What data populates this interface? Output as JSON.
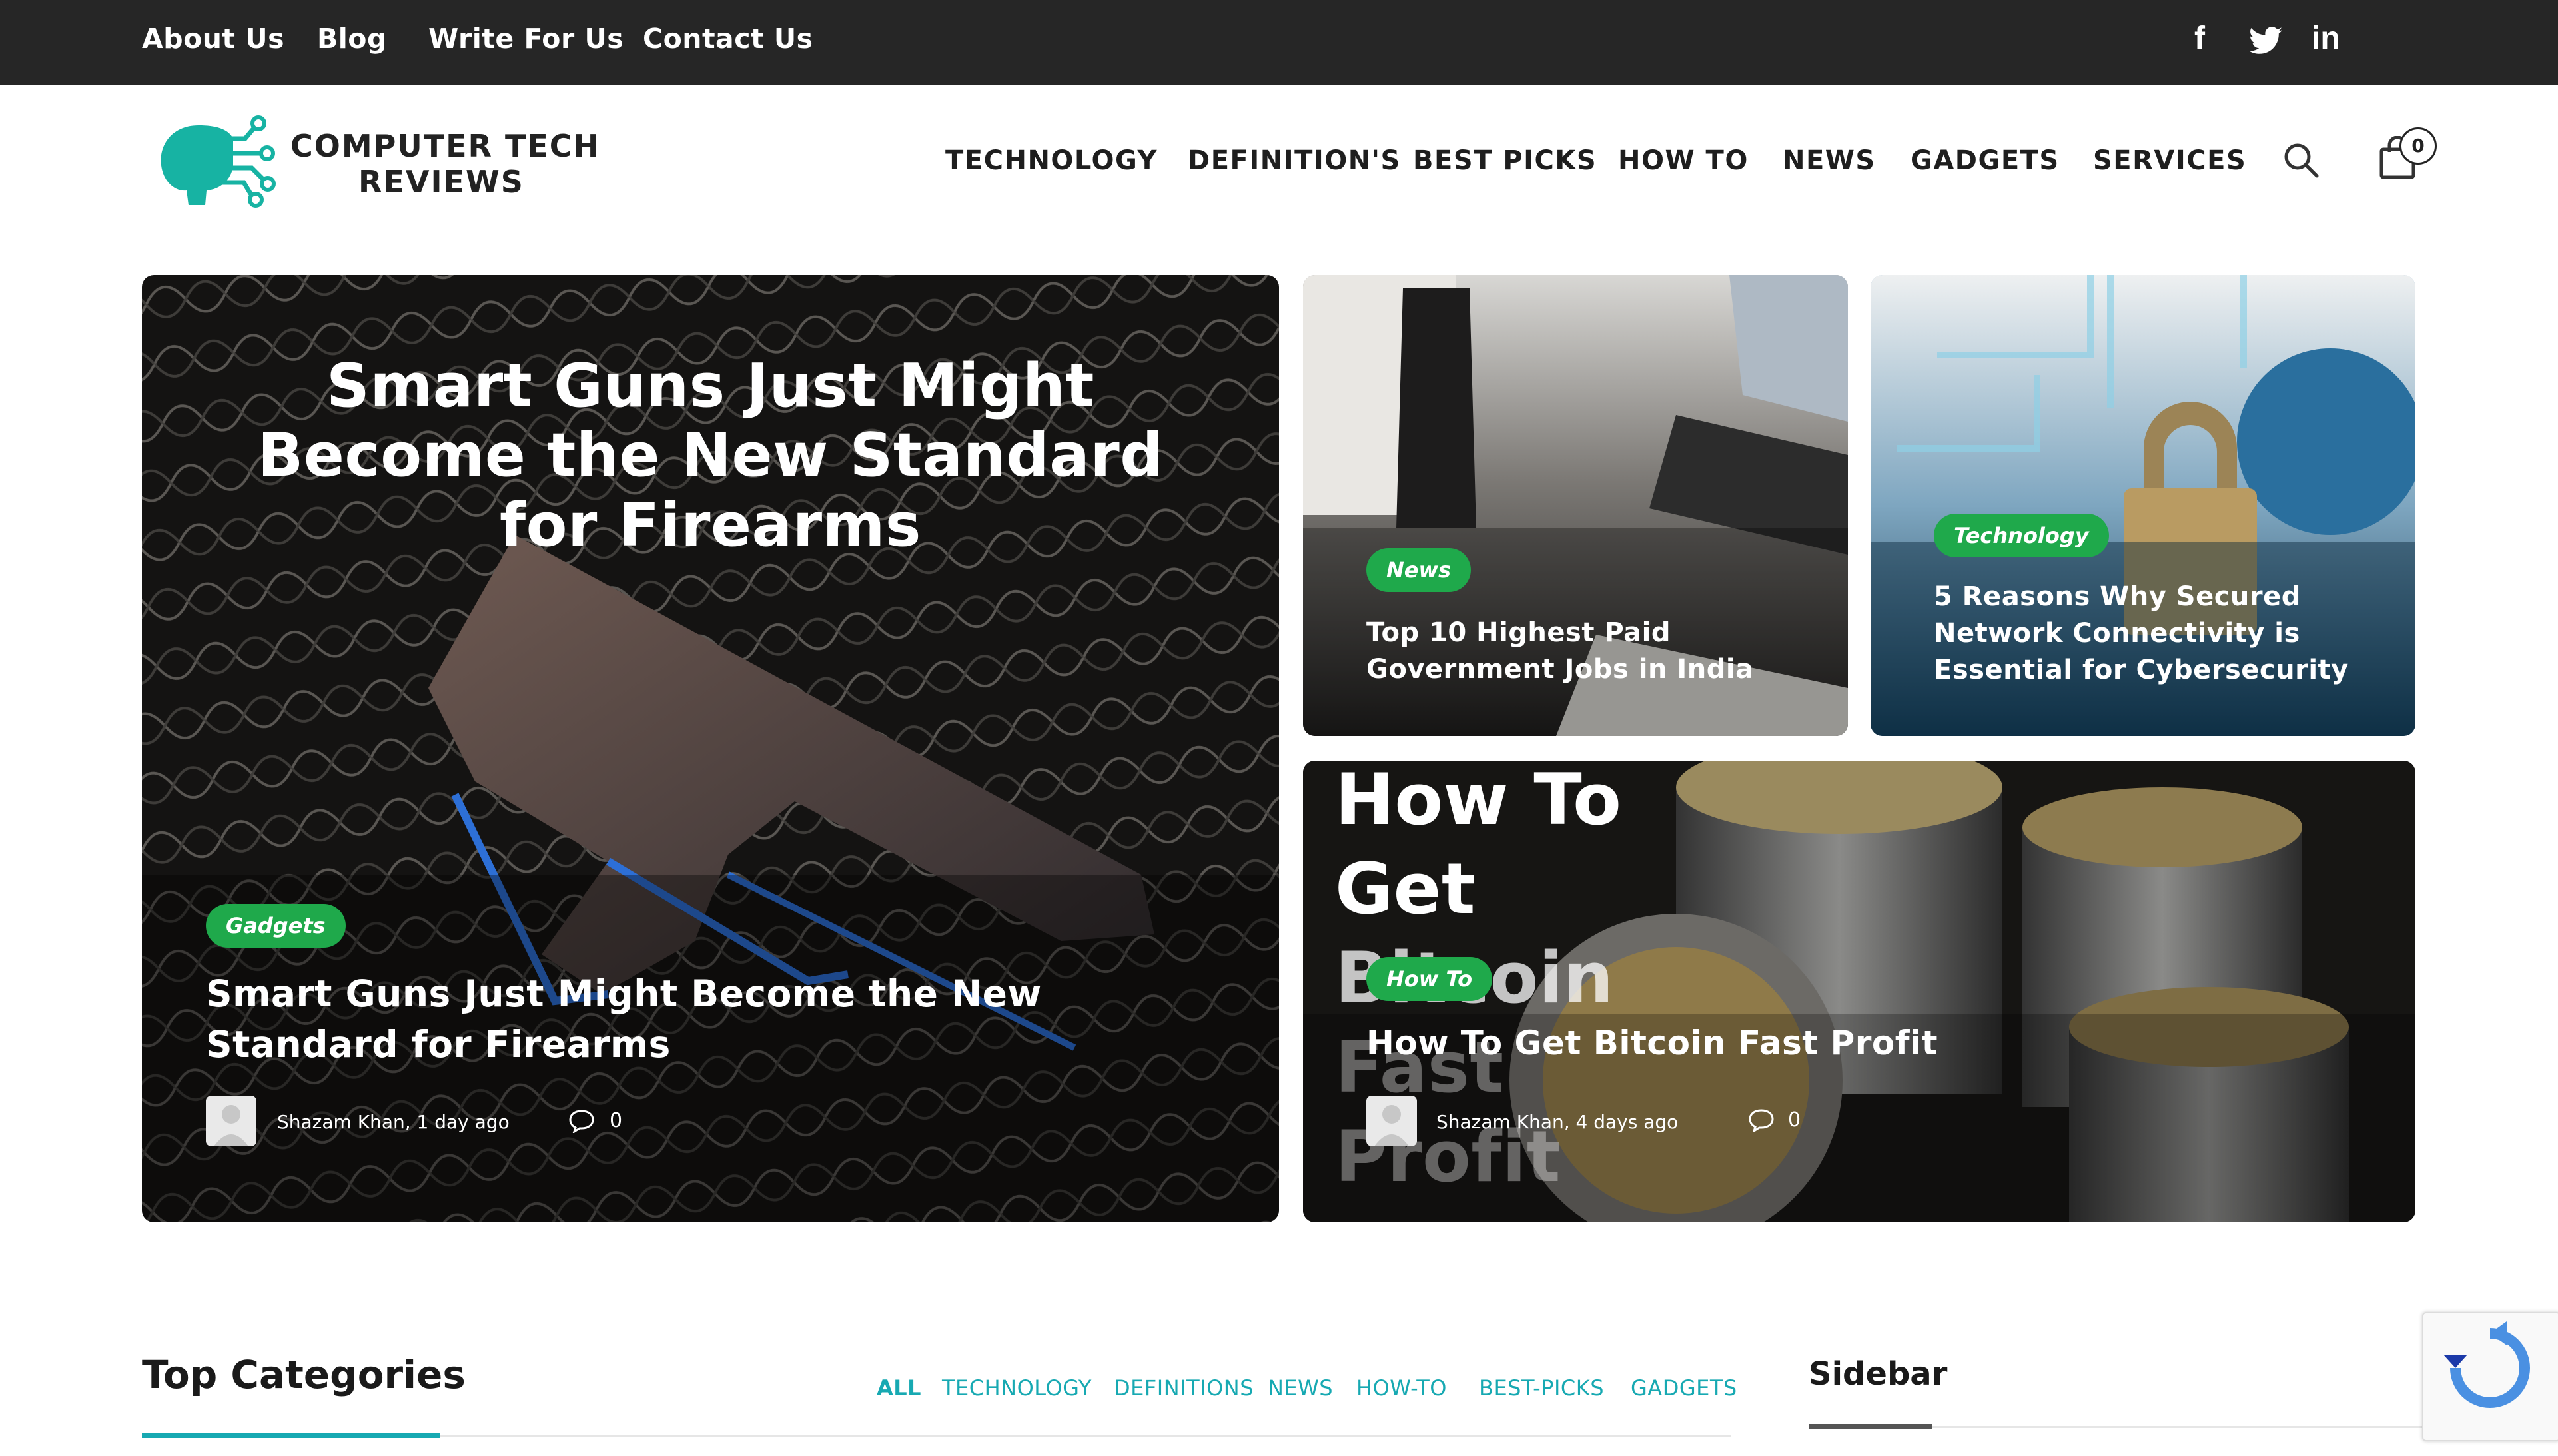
{
  "topbar": {
    "links": [
      "About Us",
      "Blog",
      "Write For Us",
      "Contact Us"
    ],
    "social": [
      "f",
      "t",
      "in"
    ]
  },
  "brand": {
    "line1": "COMPUTER TECH",
    "line2": "REVIEWS",
    "accent": "#17b3a3"
  },
  "nav": {
    "items": [
      "TECHNOLOGY",
      "DEFINITION'S",
      "BEST PICKS",
      "HOW TO",
      "NEWS",
      "GADGETS",
      "SERVICES"
    ],
    "cart_count": "0"
  },
  "featured": {
    "main": {
      "image_text": "Smart Guns Just Might Become the New Standard for Firearms",
      "badge": "Gadgets",
      "title": "Smart Guns Just Might Become the New Standard for Firearms",
      "meta": "Shazam Khan, 1 day ago",
      "comments": "0"
    },
    "news": {
      "badge": "News",
      "title": "Top 10 Highest Paid Government Jobs in India"
    },
    "tech": {
      "badge": "Technology",
      "title": "5 Reasons Why Secured Network Connectivity is Essential for Cybersecurity"
    },
    "bitcoin": {
      "image_text_lines": [
        "How To",
        "Get",
        "Bitcoin",
        "Fast",
        "Profit"
      ],
      "badge": "How To",
      "title": "How To Get Bitcoin Fast Profit",
      "meta": "Shazam Khan, 4 days ago",
      "comments": "0"
    }
  },
  "top_categories": {
    "title": "Top Categories",
    "filters": [
      "ALL",
      "TECHNOLOGY",
      "DEFINITIONS",
      "NEWS",
      "HOW-TO",
      "BEST-PICKS",
      "GADGETS"
    ]
  },
  "sidebar": {
    "title": "Sidebar"
  },
  "colors": {
    "topbar": "#262626",
    "badge_green": "#1fa94b",
    "teal": "#17a9b2"
  }
}
